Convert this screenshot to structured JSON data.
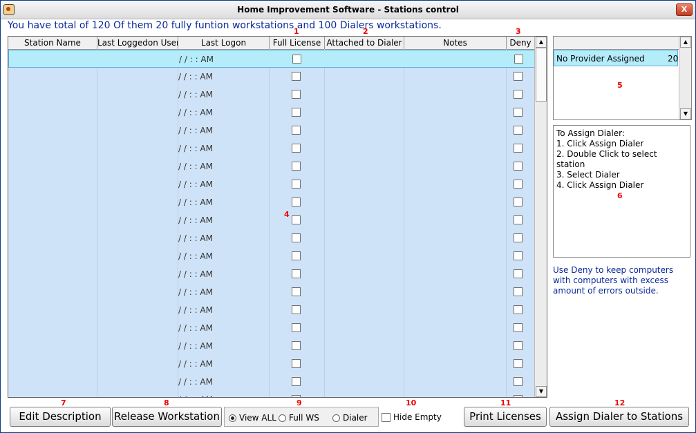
{
  "window": {
    "title": "Home Improvement Software - Stations control",
    "close_label": "X"
  },
  "header": {
    "message": "You have total of 120 Of them 20 fully funtion workstations and 100 Dialers workstations."
  },
  "grid": {
    "columns": [
      "Station Name",
      "Last Loggedon User",
      "Last Logon",
      "Full License",
      "Attached to Dialer",
      "Notes",
      "Deny"
    ],
    "logon_placeholder": "/ /    : :   AM",
    "rows": 20,
    "selected_row": 0
  },
  "providers": {
    "items": [
      {
        "name": "No Provider Assigned",
        "count": "20"
      }
    ]
  },
  "instructions": {
    "lines": [
      "To Assign Dialer:",
      "1. Click Assign Dialer",
      "2. Double Click to select station",
      "3. Select Dialer",
      "4. Click Assign Dialer"
    ]
  },
  "deny_note": "Use Deny to keep computers with computers with excess amount of errors outside.",
  "buttons": {
    "edit": "Edit Description",
    "release": "Release Workstation",
    "print": "Print Licenses",
    "assign": "Assign Dialer to Stations"
  },
  "view_filter": {
    "options": [
      "View ALL",
      "Full WS",
      "Dialer"
    ],
    "selected": "View ALL"
  },
  "hide_empty_label": "Hide Empty",
  "markers": {
    "m1": "1",
    "m2": "2",
    "m3": "3",
    "m4": "4",
    "m5": "5",
    "m6": "6",
    "m7": "7",
    "m8": "8",
    "m9": "9",
    "m10": "10",
    "m11": "11",
    "m12": "12"
  }
}
